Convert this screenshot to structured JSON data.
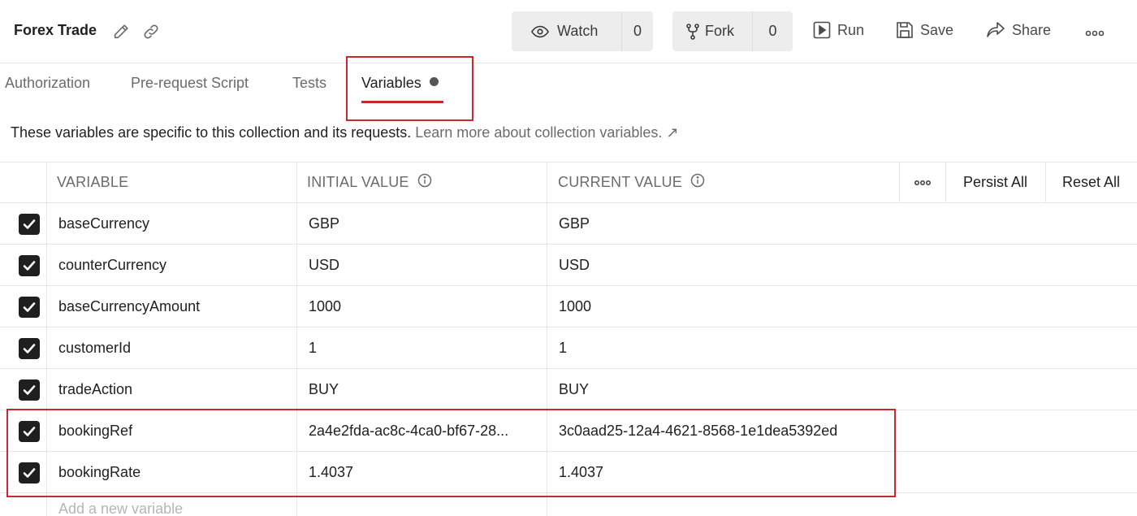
{
  "header": {
    "title": "Forex Trade",
    "watch_label": "Watch",
    "watch_count": "0",
    "fork_label": "Fork",
    "fork_count": "0",
    "run_label": "Run",
    "save_label": "Save",
    "share_label": "Share"
  },
  "tabs": [
    {
      "label": "Authorization"
    },
    {
      "label": "Pre-request Script"
    },
    {
      "label": "Tests"
    },
    {
      "label": "Variables",
      "active": true,
      "has_changes_dot": true
    }
  ],
  "description": {
    "text": "These variables are specific to this collection and its requests.",
    "link": "Learn more about collection variables. ↗"
  },
  "table": {
    "headers": {
      "variable": "VARIABLE",
      "initial_value": "INITIAL VALUE",
      "current_value": "CURRENT VALUE",
      "persist_all": "Persist All",
      "reset_all": "Reset All"
    },
    "rows": [
      {
        "checked": true,
        "variable": "baseCurrency",
        "initial": "GBP",
        "current": "GBP"
      },
      {
        "checked": true,
        "variable": "counterCurrency",
        "initial": "USD",
        "current": "USD"
      },
      {
        "checked": true,
        "variable": "baseCurrencyAmount",
        "initial": "1000",
        "current": "1000"
      },
      {
        "checked": true,
        "variable": "customerId",
        "initial": "1",
        "current": "1"
      },
      {
        "checked": true,
        "variable": "tradeAction",
        "initial": "BUY",
        "current": "BUY"
      },
      {
        "checked": true,
        "variable": "bookingRef",
        "initial": "2a4e2fda-ac8c-4ca0-bf67-28...",
        "current": "3c0aad25-12a4-4621-8568-1e1dea5392ed"
      },
      {
        "checked": true,
        "variable": "bookingRate",
        "initial": "1.4037",
        "current": "1.4037"
      }
    ],
    "add_placeholder": "Add a new variable"
  },
  "colors": {
    "highlight": "#c8282e",
    "checkbox": "#1f1f1f",
    "button_bg": "#ededed"
  }
}
